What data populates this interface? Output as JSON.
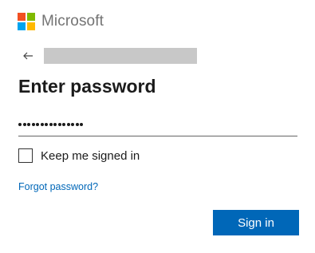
{
  "brand": {
    "name": "Microsoft",
    "logo_colors": [
      "#f25022",
      "#7fba00",
      "#00a4ef",
      "#ffb900"
    ],
    "logo_icon": "microsoft-logo"
  },
  "header": {
    "back_icon": "back-arrow-icon"
  },
  "main": {
    "title": "Enter password",
    "password_masked_length": 15,
    "keep_signed_in": {
      "label": "Keep me signed in",
      "checked": false
    },
    "forgot_link": "Forgot password?",
    "signin_button": "Sign in"
  },
  "colors": {
    "accent": "#0067b8",
    "text": "#1b1b1b"
  }
}
